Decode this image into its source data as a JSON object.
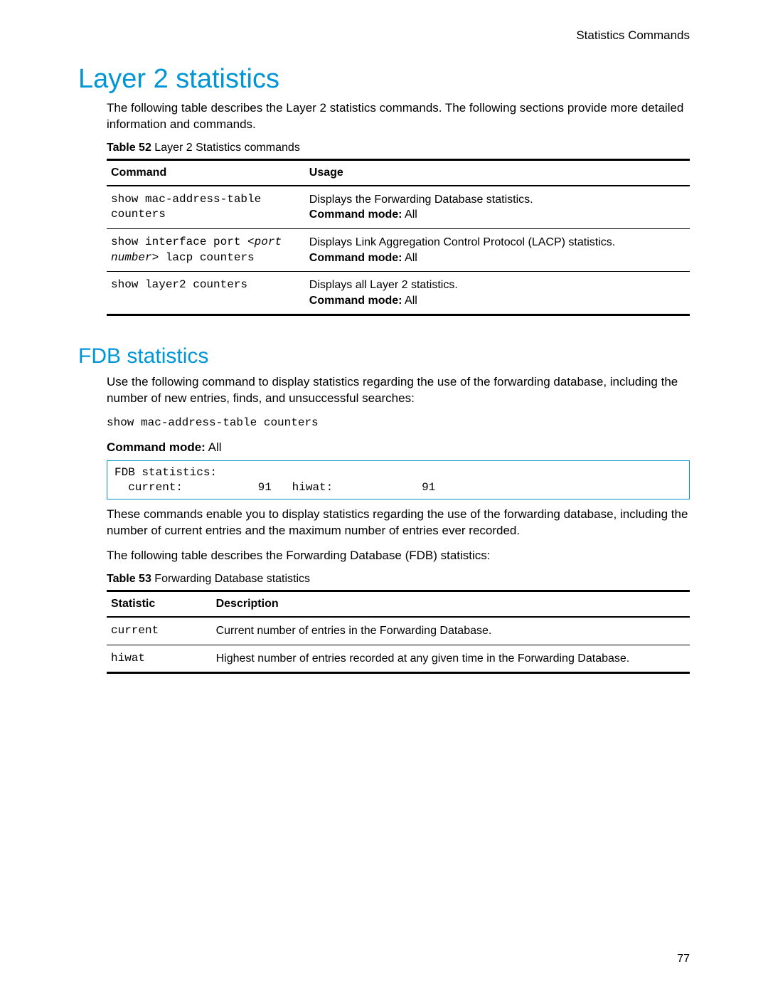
{
  "header": {
    "section_label": "Statistics Commands"
  },
  "h1": "Layer 2 statistics",
  "intro1": "The following table describes the Layer 2 statistics commands. The following sections provide more detailed information and commands.",
  "table52": {
    "caption_label": "Table 52",
    "caption_text": " Layer 2 Statistics commands",
    "head_command": "Command",
    "head_usage": "Usage",
    "mode_label": "Command mode:",
    "mode_all": " All",
    "rows": [
      {
        "cmd_plain": "show mac-address-table counters",
        "cmd_italic": "",
        "cmd_tail": "",
        "usage": "Displays the Forwarding Database statistics."
      },
      {
        "cmd_plain": "show interface port ",
        "cmd_italic": "<port number>",
        "cmd_tail": " lacp counters",
        "usage": "Displays Link Aggregation Control Protocol (LACP) statistics."
      },
      {
        "cmd_plain": "show layer2 counters",
        "cmd_italic": "",
        "cmd_tail": "",
        "usage": "Displays all Layer 2 statistics."
      }
    ]
  },
  "h2": "FDB statistics",
  "intro2": "Use the following command to display statistics regarding the use of the forwarding database, including the number of new entries, finds, and unsuccessful searches:",
  "cmd_example": "show mac-address-table counters",
  "mode_line_label": "Command mode:",
  "mode_line_value": " All",
  "output_box": "FDB statistics:\n  current:           91   hiwat:             91",
  "para3": "These commands enable you to display statistics regarding the use of the forwarding database, including the number of current entries and the maximum number of entries ever recorded.",
  "para4": "The following table describes the Forwarding Database (FDB) statistics:",
  "table53": {
    "caption_label": "Table 53",
    "caption_text": " Forwarding Database statistics",
    "head_stat": "Statistic",
    "head_desc": "Description",
    "rows": [
      {
        "stat": "current",
        "desc": "Current number of entries in the Forwarding Database."
      },
      {
        "stat": "hiwat",
        "desc": "Highest number of entries recorded at any given time in the Forwarding Database."
      }
    ]
  },
  "page_number": "77"
}
